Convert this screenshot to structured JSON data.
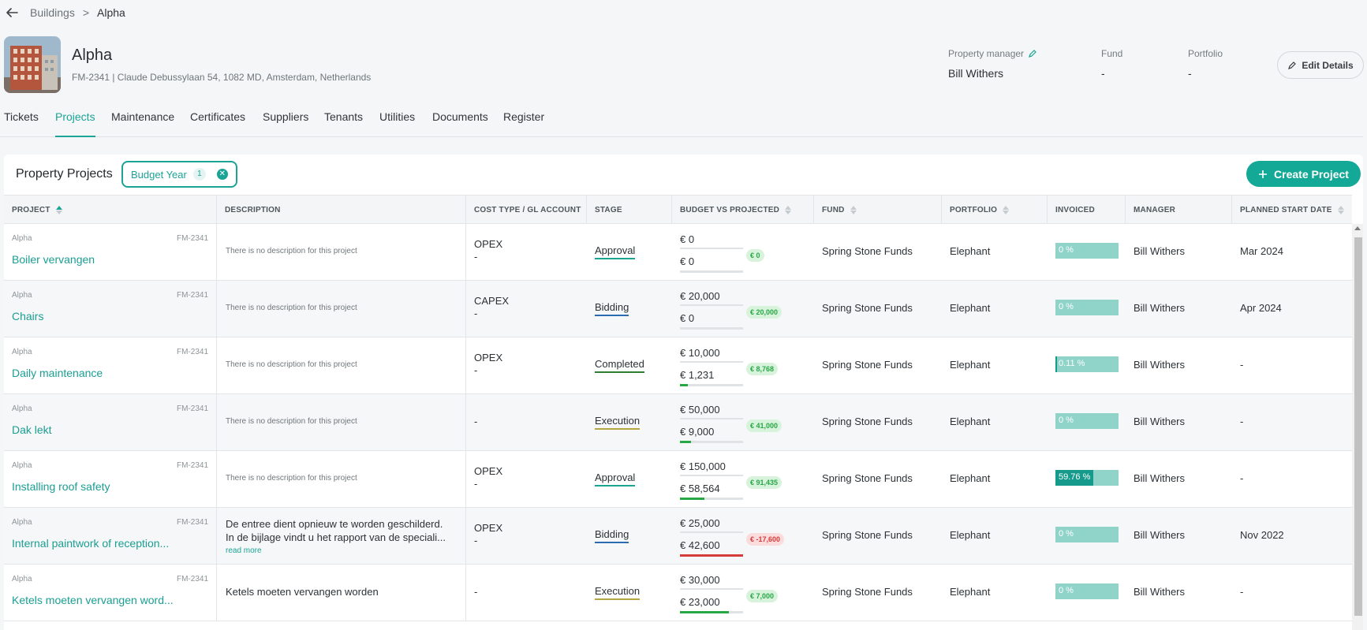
{
  "breadcrumb": {
    "parent": "Buildings",
    "separator": ">",
    "current": "Alpha"
  },
  "building": {
    "title": "Alpha",
    "address": "FM-2341 | Claude Debussylaan 54, 1082 MD, Amsterdam, Netherlands"
  },
  "meta": {
    "manager_label": "Property manager",
    "manager_value": "Bill Withers",
    "fund_label": "Fund",
    "fund_value": "-",
    "portfolio_label": "Portfolio",
    "portfolio_value": "-"
  },
  "edit_label": "Edit Details",
  "tabs": [
    "Tickets",
    "Projects",
    "Maintenance",
    "Certificates",
    "Suppliers",
    "Tenants",
    "Utilities",
    "Documents",
    "Register"
  ],
  "active_tab": "Projects",
  "card": {
    "title": "Property Projects",
    "filter_label": "Budget Year",
    "filter_count": "1",
    "create_label": "Create Project"
  },
  "columns": [
    "PROJECT",
    "DESCRIPTION",
    "COST TYPE / GL ACCOUNT",
    "STAGE",
    "BUDGET VS PROJECTED",
    "FUND",
    "PORTFOLIO",
    "INVOICED",
    "MANAGER",
    "PLANNED START DATE"
  ],
  "colors": {
    "accent": "#1ba396",
    "approval": "#1ba396",
    "bidding": "#2b6cb0",
    "completed": "#2e7d32",
    "execution": "#b5a642",
    "positive": "#28a745",
    "negative": "#d63b3b"
  },
  "rows": [
    {
      "building": "Alpha",
      "code": "FM-2341",
      "name": "Boiler vervangen",
      "description": "There is no description for this project",
      "desc_lines": [],
      "read_more": "",
      "cost_type": "OPEX",
      "gl_account": "-",
      "stage": "Approval",
      "budget": "€ 0",
      "projected": "€ 0",
      "projected_ratio": 0,
      "diff": "€ 0",
      "diff_sign": "pos",
      "fund": "Spring Stone Funds",
      "portfolio": "Elephant",
      "invoiced": "0 %",
      "invoiced_fraction": 0,
      "manager": "Bill Withers",
      "start": "Mar 2024"
    },
    {
      "building": "Alpha",
      "code": "FM-2341",
      "name": "Chairs",
      "description": "There is no description for this project",
      "desc_lines": [],
      "read_more": "",
      "cost_type": "CAPEX",
      "gl_account": "-",
      "stage": "Bidding",
      "budget": "€ 20,000",
      "projected": "€ 0",
      "projected_ratio": 0,
      "diff": "€ 20,000",
      "diff_sign": "pos",
      "fund": "Spring Stone Funds",
      "portfolio": "Elephant",
      "invoiced": "0 %",
      "invoiced_fraction": 0,
      "manager": "Bill Withers",
      "start": "Apr 2024"
    },
    {
      "building": "Alpha",
      "code": "FM-2341",
      "name": "Daily maintenance",
      "description": "There is no description for this project",
      "desc_lines": [],
      "read_more": "",
      "cost_type": "OPEX",
      "gl_account": "-",
      "stage": "Completed",
      "budget": "€ 10,000",
      "projected": "€ 1,231",
      "projected_ratio": 0.1231,
      "diff": "€ 8,768",
      "diff_sign": "pos",
      "fund": "Spring Stone Funds",
      "portfolio": "Elephant",
      "invoiced": "0.11 %",
      "invoiced_fraction": 0.0011,
      "manager": "Bill Withers",
      "start": "-"
    },
    {
      "building": "Alpha",
      "code": "FM-2341",
      "name": "Dak lekt",
      "description": "There is no description for this project",
      "desc_lines": [],
      "read_more": "",
      "cost_type": "-",
      "gl_account": "",
      "stage": "Execution",
      "budget": "€ 50,000",
      "projected": "€ 9,000",
      "projected_ratio": 0.18,
      "diff": "€ 41,000",
      "diff_sign": "pos",
      "fund": "Spring Stone Funds",
      "portfolio": "Elephant",
      "invoiced": "0 %",
      "invoiced_fraction": 0,
      "manager": "Bill Withers",
      "start": "-"
    },
    {
      "building": "Alpha",
      "code": "FM-2341",
      "name": "Installing roof safety",
      "description": "There is no description for this project",
      "desc_lines": [],
      "read_more": "",
      "cost_type": "OPEX",
      "gl_account": "-",
      "stage": "Approval",
      "budget": "€ 150,000",
      "projected": "€ 58,564",
      "projected_ratio": 0.39,
      "diff": "€ 91,435",
      "diff_sign": "pos",
      "fund": "Spring Stone Funds",
      "portfolio": "Elephant",
      "invoiced": "59.76 %",
      "invoiced_fraction": 0.5976,
      "manager": "Bill Withers",
      "start": "-"
    },
    {
      "building": "Alpha",
      "code": "FM-2341",
      "name": "Internal paintwork of reception...",
      "description": "",
      "desc_lines": [
        "De entree dient opnieuw te worden geschilderd.",
        "In de bijlage vindt u het rapport van de speciali..."
      ],
      "read_more": "read more",
      "cost_type": "OPEX",
      "gl_account": "-",
      "stage": "Bidding",
      "budget": "€ 25,000",
      "projected": "€ 42,600",
      "projected_ratio": 1,
      "diff": "€ -17,600",
      "diff_sign": "neg",
      "fund": "Spring Stone Funds",
      "portfolio": "Elephant",
      "invoiced": "0 %",
      "invoiced_fraction": 0,
      "manager": "Bill Withers",
      "start": "Nov 2022"
    },
    {
      "building": "Alpha",
      "code": "FM-2341",
      "name": "Ketels moeten vervangen word...",
      "description": "Ketels moeten vervangen worden",
      "desc_lines": [],
      "read_more": "",
      "cost_type": "-",
      "gl_account": "",
      "stage": "Execution",
      "budget": "€ 30,000",
      "projected": "€ 23,000",
      "projected_ratio": 0.77,
      "diff": "€ 7,000",
      "diff_sign": "pos",
      "fund": "Spring Stone Funds",
      "portfolio": "Elephant",
      "invoiced": "0 %",
      "invoiced_fraction": 0,
      "manager": "Bill Withers",
      "start": "-"
    }
  ]
}
